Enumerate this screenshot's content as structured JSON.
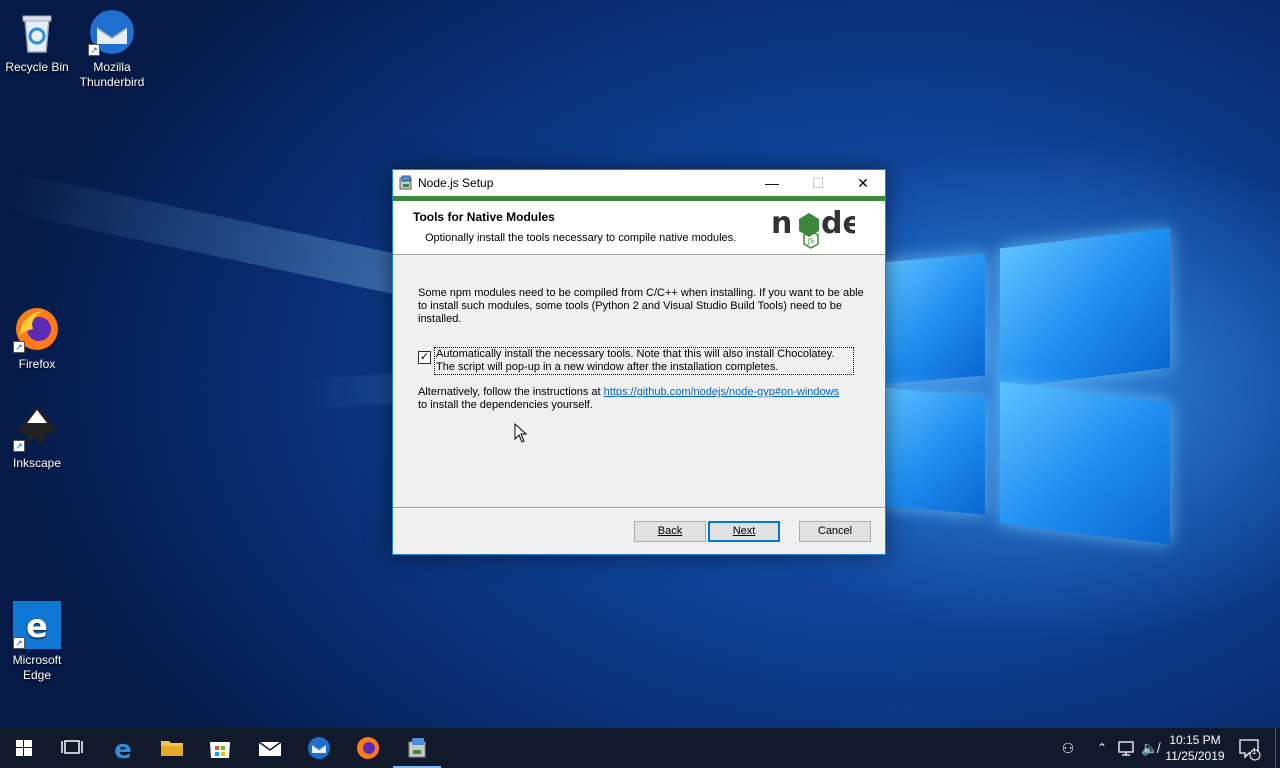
{
  "desktop": {
    "icons": [
      {
        "label": "Recycle Bin"
      },
      {
        "label": "Mozilla Thunderbird"
      },
      {
        "label": "Firefox"
      },
      {
        "label": "Inkscape"
      },
      {
        "label": "Microsoft Edge"
      }
    ]
  },
  "dialog": {
    "title": "Node.js Setup",
    "header_title": "Tools for Native Modules",
    "header_subtitle": "Optionally install the tools necessary to compile native modules.",
    "intro_text": "Some npm modules need to be compiled from C/C++ when installing. If you want to be able to install such modules, some tools (Python 2 and Visual Studio Build Tools) need to be installed.",
    "checkbox_label": "Automatically install the necessary tools. Note that this will also install Chocolatey. The script will pop-up in a new window after the installation completes.",
    "checkbox_checked": true,
    "alt_prefix": "Alternatively, follow the instructions at ",
    "alt_link": "https://github.com/nodejs/node-gyp#on-windows",
    "alt_suffix": "to install the dependencies yourself.",
    "back_label": "Back",
    "next_label": "Next",
    "cancel_label": "Cancel",
    "minimize_glyph": "—",
    "maximize_glyph": "☐",
    "close_glyph": "✕"
  },
  "taskbar": {
    "clock_time": "10:15 PM",
    "clock_date": "11/25/2019",
    "notification_count": "1"
  },
  "colors": {
    "node_green": "#3c873a",
    "accent": "#0078d7"
  }
}
